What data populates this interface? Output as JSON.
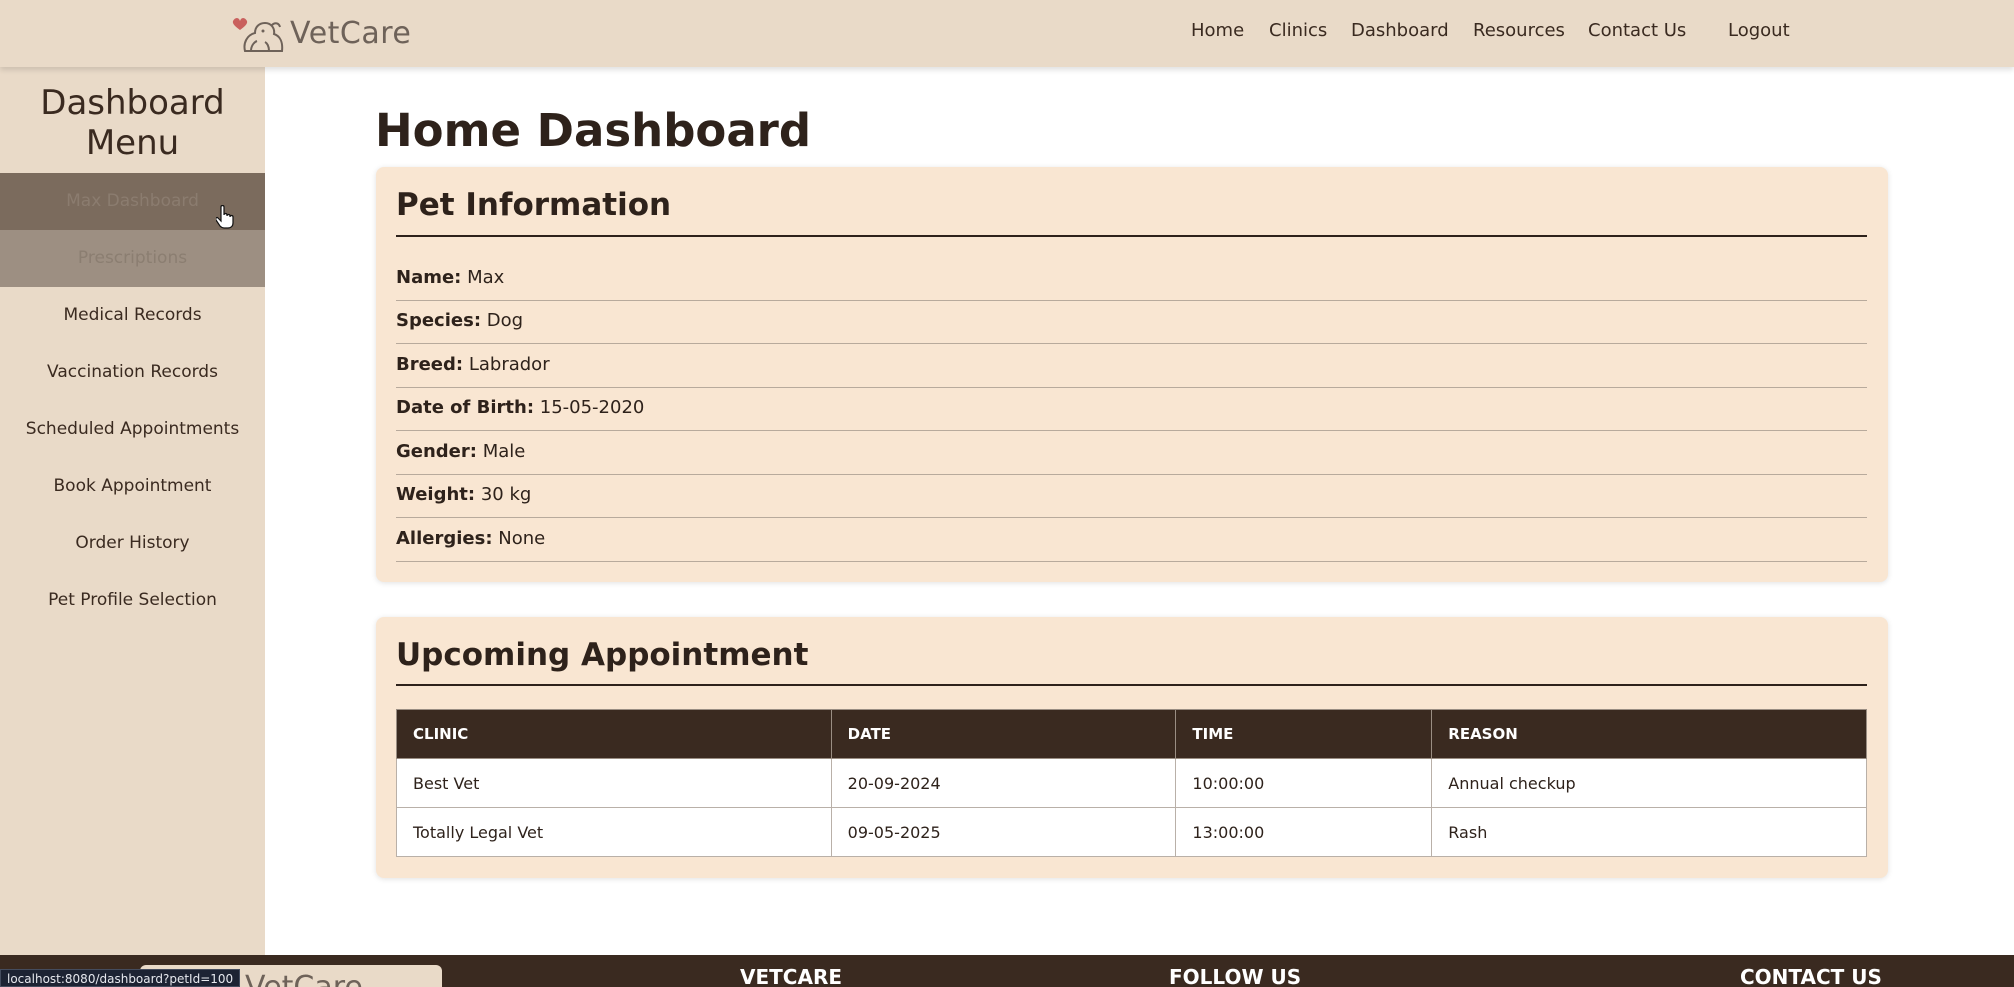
{
  "brand": {
    "name": "VetCare",
    "logo_icon": "dog-cat-heart-icon"
  },
  "nav": {
    "home": "Home",
    "clinics": "Clinics",
    "dashboard": "Dashboard",
    "resources": "Resources",
    "contact": "Contact Us",
    "logout": "Logout"
  },
  "sidebar": {
    "title_line1": "Dashboard",
    "title_line2": "Menu",
    "items": [
      "Max Dashboard",
      "Prescriptions",
      "Medical Records",
      "Vaccination Records",
      "Scheduled Appointments",
      "Book Appointment",
      "Order History",
      "Pet Profile Selection"
    ]
  },
  "main": {
    "title": "Home Dashboard",
    "pet_info": {
      "heading": "Pet Information",
      "rows": [
        {
          "label": "Name:",
          "value": "Max"
        },
        {
          "label": "Species:",
          "value": "Dog"
        },
        {
          "label": "Breed:",
          "value": "Labrador"
        },
        {
          "label": "Date of Birth:",
          "value": "15-05-2020"
        },
        {
          "label": "Gender:",
          "value": "Male"
        },
        {
          "label": "Weight:",
          "value": "30 kg"
        },
        {
          "label": "Allergies:",
          "value": "None"
        }
      ]
    },
    "appointments": {
      "heading": "Upcoming Appointment",
      "columns": [
        "CLINIC",
        "DATE",
        "TIME",
        "REASON"
      ],
      "rows": [
        [
          "Best Vet",
          "20-09-2024",
          "10:00:00",
          "Annual checkup"
        ],
        [
          "Totally Legal Vet",
          "09-05-2025",
          "13:00:00",
          "Rash"
        ]
      ]
    }
  },
  "footer": {
    "logo_text": "VetCare",
    "vetcare": "VETCARE",
    "follow": "FOLLOW US",
    "contact": "CONTACT US"
  },
  "status_bar": {
    "url": "localhost:8080/dashboard?petId=100"
  },
  "colors": {
    "nav_bg": "#e9dac8",
    "card_bg": "#f9e6d2",
    "dark_brown": "#3a2a20",
    "active_item": "#7b6b5d"
  }
}
